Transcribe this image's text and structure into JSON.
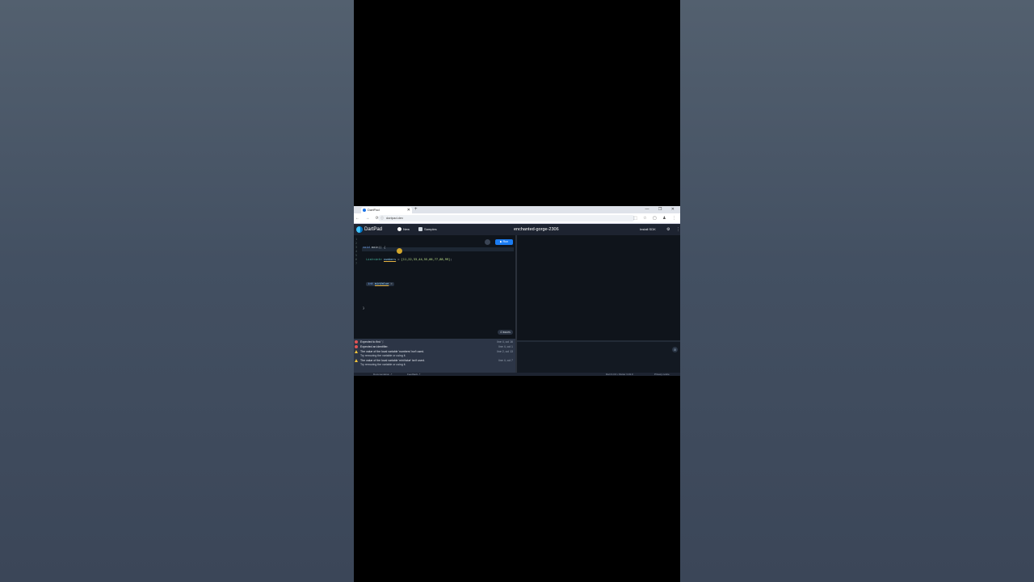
{
  "browser": {
    "tab_title": "DartPad",
    "tab_close": "✕",
    "new_tab": "+",
    "window_controls": "— ❐ ✕",
    "nav": "← → ⟳",
    "url": "dartpad.dev",
    "extensions": "⬚ ☆ ▢ ♟ ⋮"
  },
  "header": {
    "brand": "DartPad",
    "new_label": "New",
    "samples_label": "Samples",
    "project_name": "enchanted-gorge-2306",
    "install_label": "Install SDK",
    "settings_icon": "⚙",
    "more_icon": "⋮"
  },
  "editor": {
    "line_numbers": [
      "1",
      "2",
      "3",
      "4",
      "5",
      "6",
      "7"
    ],
    "code": {
      "l1_kw": "void",
      "l1_rest": " main() {",
      "l2_type": "List<int>",
      "l2_id": "numbers",
      "l2_eq": " = ",
      "l2_list": "[11,22,33,44,55,66,77,88,99]",
      "l2_end": ";",
      "l4_kw": "int",
      "l4_id": "minValue",
      "l4_eq": " =",
      "l6": "}"
    },
    "run_label": "▶ Run",
    "format_icon": "≡",
    "issues_label": "4 issues"
  },
  "problems": [
    {
      "type": "error",
      "message": "Expected to find ';'.",
      "location": "line 4, col 16"
    },
    {
      "type": "error",
      "message": "Expected an identifier.",
      "location": "line 4, col 1"
    },
    {
      "type": "warning",
      "message": "The value of the local variable 'numbers' isn't used.",
      "location": "line 2, col 13"
    },
    {
      "type": "hint",
      "message": "Try removing the variable or using it.",
      "location": ""
    },
    {
      "type": "warning",
      "message": "The value of the local variable 'minValue' isn't used.",
      "location": "line 4, col 7"
    },
    {
      "type": "hint",
      "message": "Try removing the variable or using it.",
      "location": ""
    }
  ],
  "output": {
    "clear_icon": "⊘"
  },
  "statusbar": {
    "left1": "Documentation ↗",
    "left2": "Feedback ↗",
    "right1": "Dart 3.3.0 • Flutter 3.19.0",
    "right2": "Privacy notice"
  }
}
